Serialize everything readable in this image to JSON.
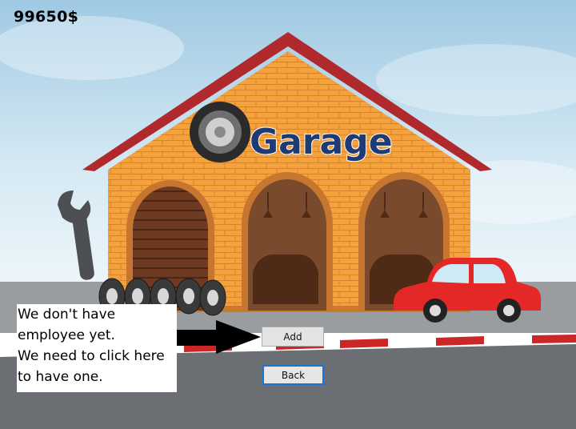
{
  "hud": {
    "money": "99650$"
  },
  "sign": {
    "text": "Garage"
  },
  "hint": {
    "lines": [
      "We don't have",
      "employee yet.",
      "We need to click here",
      "to have one."
    ]
  },
  "buttons": {
    "add_label": "Add",
    "back_label": "Back"
  },
  "colors": {
    "sky_top": "#a9cfe6",
    "sky_bottom": "#e8f3f9",
    "roof": "#b0292c",
    "brick": "#f4a23d",
    "door": "#7a4a2c",
    "road": "#6b6e72",
    "curb_red": "#cc2727",
    "car_red": "#e42828",
    "sign_text": "#1e3b73",
    "button_focus": "#1b73d6"
  }
}
